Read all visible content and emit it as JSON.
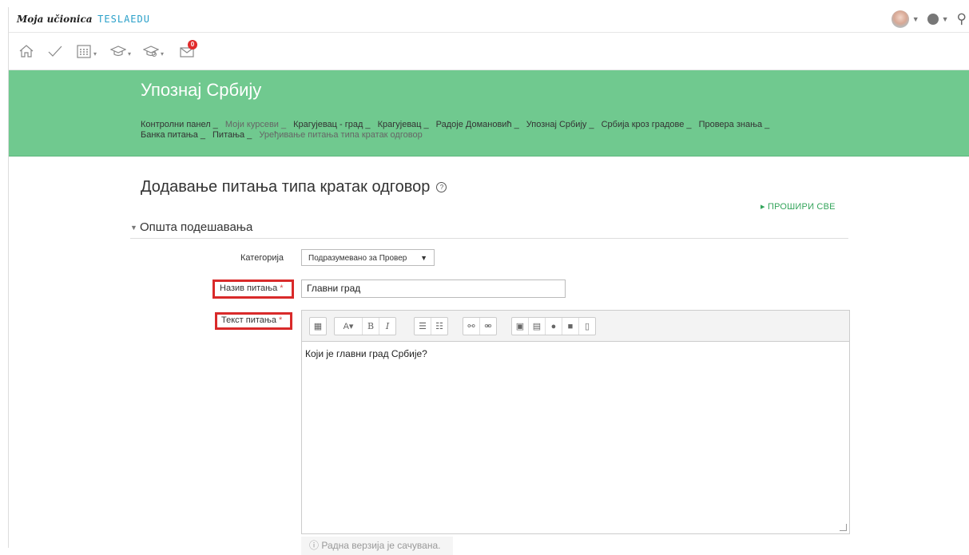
{
  "header": {
    "logo_main": "Moja učionica",
    "logo_brand": "TESLAEDU"
  },
  "icons": {
    "home": "home-icon",
    "check": "check-icon",
    "calendar": "calendar-icon",
    "courses": "graduation-cap-icon",
    "admin_courses": "graduation-cap-settings-icon",
    "messages": "envelope-icon",
    "globe": "globe-icon",
    "search": "search-icon"
  },
  "notifications": {
    "messages_count": "0"
  },
  "hero": {
    "title": "Упознај Србију",
    "breadcrumbs": [
      "Контролни панел",
      "Моји курсеви",
      "Крагујевац - град",
      "Крагујевац",
      "Радоје Домановић",
      "Упознај Србију",
      "Србија кроз градове",
      "Провера знања",
      "Банка питања",
      "Питања",
      "Уређивање питања типа кратак одговор"
    ],
    "separator": "_"
  },
  "page": {
    "title": "Додавање питања типа кратак одговор",
    "help_symbol": "?",
    "expand_all": "ПРОШИРИ СВЕ",
    "section_title": "Општа подешавања"
  },
  "form": {
    "category_label": "Категорија",
    "category_value": "Подразумевано за Провер",
    "name_label": "Назив питања",
    "name_value": "Главни град",
    "text_label": "Текст питања",
    "required_mark": "*",
    "text_value": "Који је главни град Србије?",
    "draft_note": "ⓘ Радна верзија је сачувана."
  },
  "colors": {
    "hero_bg": "#70c98f",
    "accent": "#34a55b",
    "highlight": "#d92a2a",
    "badge": "#e12b2b"
  }
}
